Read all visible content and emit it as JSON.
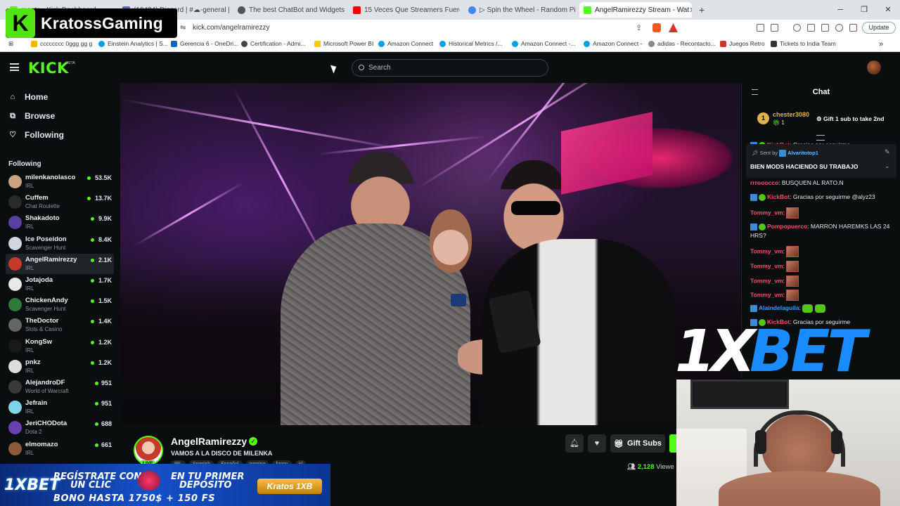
{
  "browser": {
    "tabs": [
      {
        "title": "ments - Kick Dashboard",
        "color": "#53fc18"
      },
      {
        "title": "(10484) Discord | #☁-general | Krato",
        "color": "#5865f2"
      },
      {
        "title": "The best ChatBot and Widgets for Ki",
        "color": "#555555"
      },
      {
        "title": "15 Veces Que Streamers Fueron BAN",
        "color": "#ff0000"
      },
      {
        "title": "▷ Spin the Wheel - Random Picker –",
        "color": "#4285f4"
      },
      {
        "title": "AngelRamirezzy Stream - Wat",
        "color": "#53fc18"
      }
    ],
    "url": "kick.com/angelramirezzy",
    "update_label": "Update",
    "bookmarks": [
      {
        "label": "cccccccc 0ggg gg g",
        "color": "#f4b400"
      },
      {
        "label": "Einstein Analytics | S...",
        "color": "#00a1e0"
      },
      {
        "label": "Gerencia 6 - OneDri...",
        "color": "#0a66c2"
      },
      {
        "label": "Certification - Admi...",
        "color": "#444444"
      },
      {
        "label": "Microsoft Power BI",
        "color": "#f2c811"
      },
      {
        "label": "Amazon Connect",
        "color": "#00a1e0"
      },
      {
        "label": "Historical Metrics /...",
        "color": "#00a1e0"
      },
      {
        "label": "Amazon Connect -...",
        "color": "#00a1e0"
      },
      {
        "label": "Amazon Connect -",
        "color": "#00a1e0"
      },
      {
        "label": "adidas - Recontacto...",
        "color": "#888888"
      },
      {
        "label": "Juegos Retro",
        "color": "#c0392b"
      },
      {
        "label": "Tickets to India Team",
        "color": "#333333"
      }
    ]
  },
  "overlay": {
    "channel_logo_text": "KratossGaming",
    "channel_badge": "K"
  },
  "header": {
    "logo": "KICK",
    "beta": "BETA",
    "search_placeholder": "Search"
  },
  "sidebar": {
    "nav": [
      {
        "label": "Home",
        "icon": "home-icon",
        "glyph": "⌂"
      },
      {
        "label": "Browse",
        "icon": "browse-icon",
        "glyph": "⧉"
      },
      {
        "label": "Following",
        "icon": "heart-icon",
        "glyph": "♡"
      }
    ],
    "following_heading": "Following",
    "following": [
      {
        "name": "milenkanolasco",
        "category": "IRL",
        "viewers": "53.5K",
        "color": "#c9a27f"
      },
      {
        "name": "Cuffem",
        "category": "Chat Roulette",
        "viewers": "13.7K",
        "color": "#2a2a2a"
      },
      {
        "name": "Shakadoto",
        "category": "IRL",
        "viewers": "9.9K",
        "color": "#5a3fa0"
      },
      {
        "name": "Ice Poseidon",
        "category": "Scavenger Hunt",
        "viewers": "8.4K",
        "color": "#d0d6e0"
      },
      {
        "name": "AngelRamirezzy",
        "category": "IRL",
        "viewers": "2.1K",
        "color": "#c43b2c"
      },
      {
        "name": "Jotajoda",
        "category": "IRL",
        "viewers": "1.7K",
        "color": "#e8e8e8"
      },
      {
        "name": "ChickenAndy",
        "category": "Scavenger Hunt",
        "viewers": "1.5K",
        "color": "#2d7a3a"
      },
      {
        "name": "TheDoctor",
        "category": "Slots & Casino",
        "viewers": "1.4K",
        "color": "#666666"
      },
      {
        "name": "KongSw",
        "category": "IRL",
        "viewers": "1.2K",
        "color": "#1a1a1a"
      },
      {
        "name": "pnkz",
        "category": "IRL",
        "viewers": "1.2K",
        "color": "#dcdcdc"
      },
      {
        "name": "AlejandroDF",
        "category": "World of Warcraft",
        "viewers": "951",
        "color": "#3a3a3a"
      },
      {
        "name": "Jefrain",
        "category": "IRL",
        "viewers": "951",
        "color": "#7fd6e8"
      },
      {
        "name": "JeriCHODota",
        "category": "Dota 2",
        "viewers": "688",
        "color": "#6a3fb0"
      },
      {
        "name": "elmomazo",
        "category": "IRL",
        "viewers": "661",
        "color": "#8a5a3a"
      }
    ]
  },
  "stream": {
    "streamer": "AngelRamirezzy",
    "title": "VAMOS A LA DISCO DE MILENKA",
    "live_label": "LIVE",
    "tags": [
      "IRL",
      "Spanish",
      "Español",
      "gaming",
      "funny",
      "irl"
    ],
    "viewer_count": "2,128",
    "viewer_label": "Viewe",
    "gift_subs_label": "Gift Subs"
  },
  "chat": {
    "title": "Chat",
    "gift": {
      "user": "chester3080",
      "count": "1",
      "badge": "1",
      "cta": "Gift 1 sub to take 2nd"
    },
    "pinned": {
      "sent_by_label": "Sent by",
      "user": "Alvaritotop1",
      "message": "BIEN MODS HACIENDO SU TRABAJO"
    },
    "messages": [
      {
        "user": "KickBot",
        "user_color": "#ff4d6d",
        "text": ": Gracias por seguirme",
        "badges": 2,
        "emotes": 0
      },
      {
        "user": "rrrooocco",
        "user_color": "#ff4d6d",
        "text": ": BUSQUEN AL RATO.N",
        "badges": 0,
        "emotes": 0
      },
      {
        "user": "KickBot",
        "user_color": "#ff4d6d",
        "text": ": Gracias por seguirme @alyz23",
        "badges": 2,
        "emotes": 0
      },
      {
        "user": "Tommy_vm",
        "user_color": "#ff4d6d",
        "text": ":",
        "badges": 0,
        "emotes": 1
      },
      {
        "user": "Pompopuerco",
        "user_color": "#ff4d6d",
        "text": ": MARRON HAREMKS LAS 24 HRS?",
        "badges": 2,
        "emotes": 0
      },
      {
        "user": "Tommy_vm",
        "user_color": "#ff4d6d",
        "text": ":",
        "badges": 0,
        "emotes": 1
      },
      {
        "user": "Tommy_vm",
        "user_color": "#ff4d6d",
        "text": ":",
        "badges": 0,
        "emotes": 1
      },
      {
        "user": "Tommy_vm",
        "user_color": "#ff4d6d",
        "text": ":",
        "badges": 0,
        "emotes": 1
      },
      {
        "user": "Tommy_vm",
        "user_color": "#ff4d6d",
        "text": ":",
        "badges": 0,
        "emotes": 1
      },
      {
        "user": "Alaindelaguila",
        "user_color": "#3aa0ff",
        "text": ":",
        "badges": 1,
        "emotes": 2
      },
      {
        "user": "KickBot",
        "user_color": "#ff4d6d",
        "text": ": Gracias por seguirme",
        "badges": 2,
        "emotes": 0
      }
    ]
  },
  "ads": {
    "sponsor_logo": "1XBET",
    "banner_logo": "1XBET",
    "banner_line1": "REGÍSTRATE CON",
    "banner_line1b": "UN CLIC",
    "banner_line2": "EN TU PRIMER",
    "banner_line2b": "DEPÓSITO",
    "banner_line3": "BONO HASTA 1750$ + 150 FS",
    "banner_chip": "Kratos 1XB"
  },
  "colors": {
    "kick_green": "#53fc18",
    "bg": "#0b0e0f",
    "accent_blue": "#1650c8"
  }
}
